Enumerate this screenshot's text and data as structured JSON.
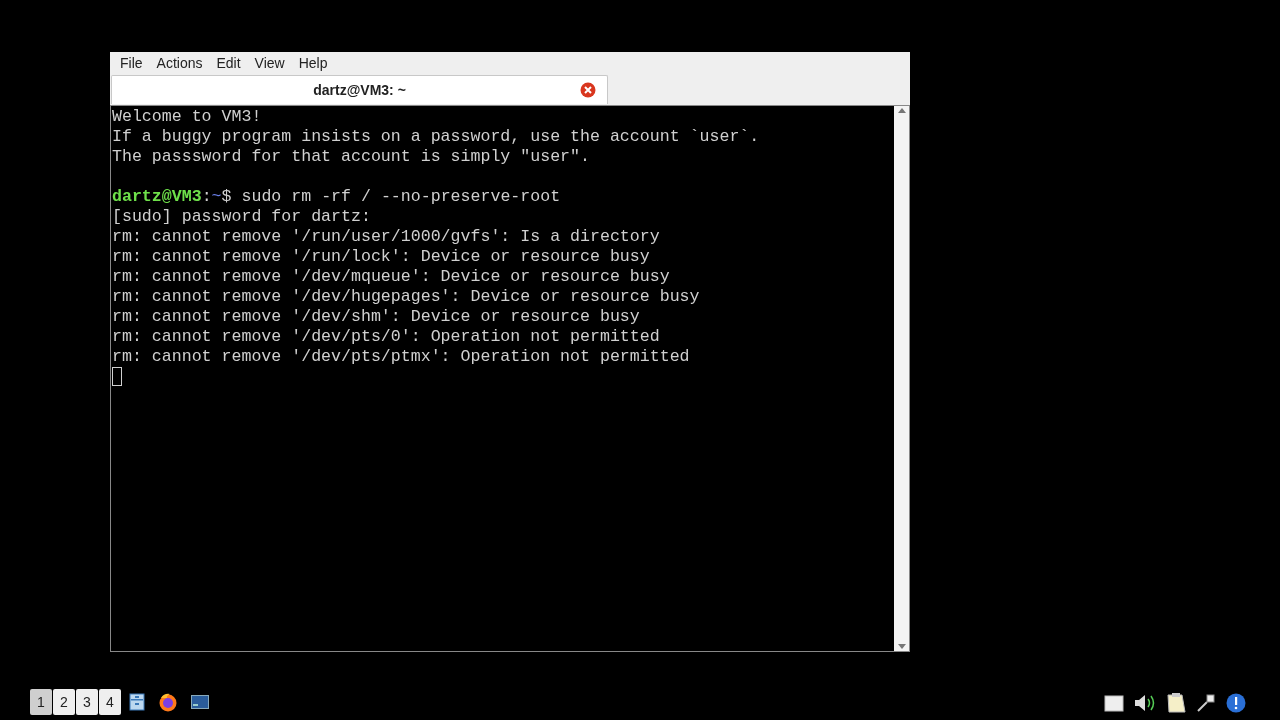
{
  "menu": [
    "File",
    "Actions",
    "Edit",
    "View",
    "Help"
  ],
  "tabs": [
    {
      "label": "dartz@VM3: ~",
      "selected": true
    }
  ],
  "terminal": [
    {
      "kind": "text",
      "text": "Welcome to VM3!"
    },
    {
      "kind": "text",
      "text": "If a buggy program insists on a password, use the account `user`."
    },
    {
      "kind": "text",
      "text": "The passsword for that account is simply \"user\"."
    },
    {
      "kind": "blank"
    },
    {
      "kind": "prompt",
      "user": "dartz@VM3",
      "sep": ":",
      "path": "~",
      "command": "$ sudo rm -rf / --no-preserve-root"
    },
    {
      "kind": "text",
      "text": "[sudo] password for dartz:"
    },
    {
      "kind": "text",
      "text": "rm: cannot remove '/run/user/1000/gvfs': Is a directory"
    },
    {
      "kind": "text",
      "text": "rm: cannot remove '/run/lock': Device or resource busy"
    },
    {
      "kind": "text",
      "text": "rm: cannot remove '/dev/mqueue': Device or resource busy"
    },
    {
      "kind": "text",
      "text": "rm: cannot remove '/dev/hugepages': Device or resource busy"
    },
    {
      "kind": "text",
      "text": "rm: cannot remove '/dev/shm': Device or resource busy"
    },
    {
      "kind": "text",
      "text": "rm: cannot remove '/dev/pts/0': Operation not permitted"
    },
    {
      "kind": "text",
      "text": "rm: cannot remove '/dev/pts/ptmx': Operation not permitted"
    },
    {
      "kind": "cursor"
    }
  ],
  "workspaces": [
    {
      "label": "1",
      "selected": true
    },
    {
      "label": "2",
      "selected": false
    },
    {
      "label": "3",
      "selected": false
    },
    {
      "label": "4",
      "selected": false
    }
  ]
}
